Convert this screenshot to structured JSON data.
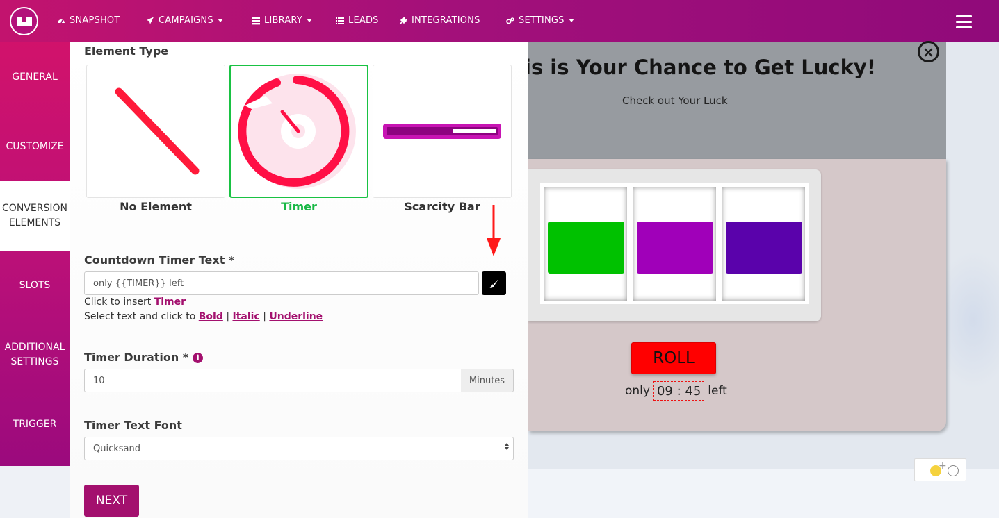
{
  "nav": {
    "items": [
      {
        "label": "SNAPSHOT",
        "icon": "dashboard-icon"
      },
      {
        "label": "CAMPAIGNS",
        "icon": "paper-plane-icon"
      },
      {
        "label": "LIBRARY",
        "icon": "library-icon"
      },
      {
        "label": "LEADS",
        "icon": "list-icon"
      },
      {
        "label": "INTEGRATIONS",
        "icon": "plug-icon"
      },
      {
        "label": "SETTINGS",
        "icon": "cogs-icon"
      }
    ]
  },
  "sidebar": {
    "items": [
      {
        "label": "GENERAL"
      },
      {
        "label": "CUSTOMIZE"
      },
      {
        "label": "CONVERSION ELEMENTS"
      },
      {
        "label": "SLOTS"
      },
      {
        "label": "ADDITIONAL SETTINGS"
      },
      {
        "label": "TRIGGER"
      }
    ],
    "active": "CONVERSION ELEMENTS"
  },
  "panel": {
    "element_type_label": "Element Type",
    "cards": [
      {
        "label": "No Element"
      },
      {
        "label": "Timer"
      },
      {
        "label": "Scarcity Bar"
      }
    ],
    "selected_card": "Timer",
    "countdown_label": "Countdown Timer Text *",
    "countdown_value": "only {{TIMER}} left",
    "insert_help": "Click to insert",
    "insert_link": "Timer",
    "format_help": "Select text and click to",
    "format_links": [
      "Bold",
      "Italic",
      "Underline"
    ],
    "format_sep": "|",
    "duration_label": "Timer Duration *",
    "duration_value": "10",
    "duration_unit": "Minutes",
    "font_label": "Timer Text Font",
    "font_value": "Quicksand",
    "next_label": "NEXT"
  },
  "preview": {
    "title": "is is Your Chance to Get Lucky!",
    "subtitle": "Check out Your Luck",
    "close_symbol": "×",
    "reel_colors": [
      "#00c100",
      "#a000b9",
      "#5a02ab"
    ],
    "roll_label": "ROLL",
    "timer_prefix": "only",
    "timer_value": "09 : 45",
    "timer_suffix": "left"
  },
  "colors": {
    "brand": "#a3106e",
    "selected": "#19c243",
    "timer_red": "#ff0f45",
    "roll": "#ff0000"
  }
}
